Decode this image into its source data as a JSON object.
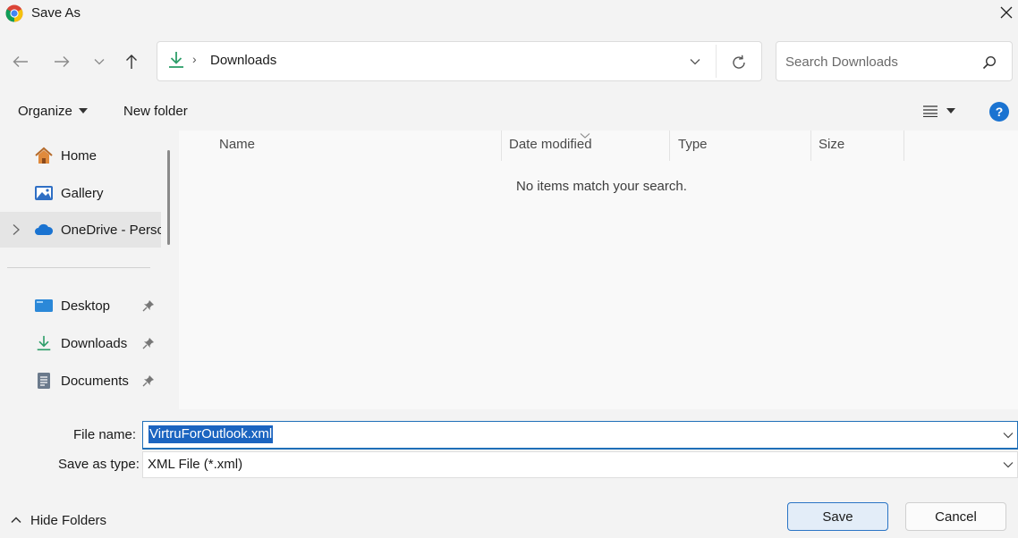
{
  "window": {
    "title": "Save As"
  },
  "address": {
    "current_folder": "Downloads",
    "separator": "›"
  },
  "search": {
    "placeholder": "Search Downloads"
  },
  "toolbar": {
    "organize_label": "Organize",
    "new_folder_label": "New folder",
    "help_label": "?"
  },
  "sidebar": {
    "items": [
      {
        "label": "Home",
        "icon": "home-icon"
      },
      {
        "label": "Gallery",
        "icon": "gallery-icon"
      },
      {
        "label": "OneDrive - Persc",
        "icon": "cloud-icon"
      },
      {
        "label": "Desktop",
        "icon": "desktop-icon",
        "pinned": true
      },
      {
        "label": "Downloads",
        "icon": "download-icon",
        "pinned": true
      },
      {
        "label": "Documents",
        "icon": "document-icon",
        "pinned": true
      }
    ]
  },
  "file_list": {
    "columns": [
      "Name",
      "Date modified",
      "Type",
      "Size"
    ],
    "empty_message": "No items match your search."
  },
  "form": {
    "filename_label": "File name:",
    "filename_value": "VirtruForOutlook.xml",
    "type_label": "Save as type:",
    "type_value": "XML File (*.xml)"
  },
  "footer": {
    "hide_folders_label": "Hide Folders",
    "save_label": "Save",
    "cancel_label": "Cancel"
  },
  "colors": {
    "accent": "#1b64c0",
    "folder_green": "#2e9e6a",
    "help_blue": "#1a73d1"
  }
}
